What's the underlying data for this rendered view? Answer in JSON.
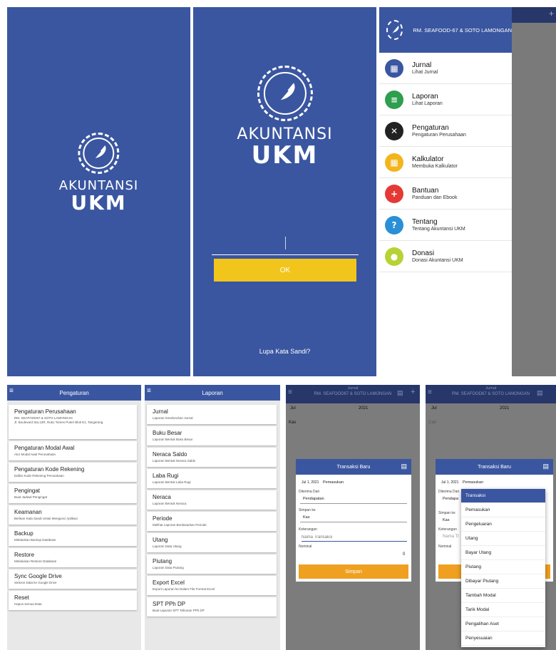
{
  "brand": {
    "word1": "AKUNTANSI",
    "word2": "UKM"
  },
  "login": {
    "ok_label": "OK",
    "forgot_label": "Lupa Kata Sandi?"
  },
  "drawer": {
    "title": "RM. SEAFOOD-67 & SOTO LAMONGAN",
    "items": [
      {
        "title": "Jurnal",
        "sub": "Lihat Jurnal",
        "icon": "calendar-icon",
        "color": "#3a56a0"
      },
      {
        "title": "Laporan",
        "sub": "Lihat Laporan",
        "icon": "document-icon",
        "color": "#2e9e4f"
      },
      {
        "title": "Pengaturan",
        "sub": "Pengaturan Perusahaan",
        "icon": "tools-icon",
        "color": "#222222"
      },
      {
        "title": "Kalkulator",
        "sub": "Membuka Kalkulator",
        "icon": "calculator-icon",
        "color": "#f2b51c"
      },
      {
        "title": "Bantuan",
        "sub": "Panduan dan Ebook",
        "icon": "plus-icon",
        "color": "#e53935"
      },
      {
        "title": "Tentang",
        "sub": "Tentang Akuntansi UKM",
        "icon": "question-icon",
        "color": "#2a8fd6"
      },
      {
        "title": "Donasi",
        "sub": "Donasi Akuntansi UKM",
        "icon": "coin-icon",
        "color": "#b5d334"
      }
    ]
  },
  "pengaturan": {
    "appbar": "Pengaturan",
    "items": [
      {
        "title": "Pengaturan Perusahaan",
        "sub": "RM. SEAFOOD67 & SOTO LAMONGAN",
        "sub2": "Jl. Boulevard Sta.12R, Ruko Tomes Puteri Blok E1, Tangerang"
      },
      {
        "title": "Pengaturan Modal Awal",
        "sub": "Atur Modal Awal Perusahaan"
      },
      {
        "title": "Pengaturan Kode Rekening",
        "sub": "Daftar Kode Rekening Perusahaan"
      },
      {
        "title": "Pengingat",
        "sub": "Buat Jadwal Pengingat"
      },
      {
        "title": "Keamanan",
        "sub": "Berikan Kata Sandi Untuk Mengunci Aplikasi"
      },
      {
        "title": "Backup",
        "sub": "Melakukan Backup Database"
      },
      {
        "title": "Restore",
        "sub": "Melakukan Restore Database"
      },
      {
        "title": "Sync Google Drive",
        "sub": "Sinkron Data ke Google Drive"
      },
      {
        "title": "Reset",
        "sub": "Hapus semua Data"
      }
    ]
  },
  "laporan": {
    "appbar": "Laporan",
    "items": [
      {
        "title": "Jurnal",
        "sub": "Laporan Keseluruhan Jurnal"
      },
      {
        "title": "Buku Besar",
        "sub": "Laporan Bentuk Buku Besar"
      },
      {
        "title": "Neraca Saldo",
        "sub": "Laporan Bentuk Neraca Saldo"
      },
      {
        "title": "Laba Rugi",
        "sub": "Laporan Bentuk Laba Rugi"
      },
      {
        "title": "Neraca",
        "sub": "Laporan Bentuk Neraca"
      },
      {
        "title": "Periode",
        "sub": "Melihat Laporan Berdasarkan Periode"
      },
      {
        "title": "Utang",
        "sub": "Laporan Data Utang"
      },
      {
        "title": "Piutang",
        "sub": "Laporan Data Piutang"
      },
      {
        "title": "Export Excel",
        "sub": "Export Laporan ke Dalam File Format Excel"
      },
      {
        "title": "SPT PPh DP",
        "sub": "Buat Laporan SPT Tahunan PPh DP"
      }
    ]
  },
  "jurnal": {
    "appbar_title": "Jurnal",
    "appbar_sub": "RM. SEAFOOD67 & SOTO LAMONGAN",
    "month": "Jul",
    "year": "2021",
    "kas": "Kas",
    "cari": "Cari"
  },
  "transaksi": {
    "title": "Transaksi Baru",
    "date": "Jul 1, 2021",
    "type": "Pemasukan",
    "diterima_label": "Diterima Dari",
    "diterima_value": "Pendapatan",
    "simpan_ke_label": "Simpan ke",
    "simpan_ke_value": "Kas",
    "keterangan_label": "Keterangan",
    "nama_placeholder": "Nama Transaksi",
    "nominal_label": "Nominal",
    "nominal_value": "0",
    "simpan_label": "Simpan",
    "dd_diterima": "Diterima Dari",
    "dd_pendapatan": "Pendapa",
    "dd_simpan": "Simpan ke",
    "dd_kas": "Kas",
    "dd_keterangan": "Keterangan",
    "dd_nama": "Nama Tr",
    "dd_nominal": "Nominal",
    "dropdown": [
      "Transaksi",
      "Pemasukan",
      "Pengeluaran",
      "Utang",
      "Bayar Utang",
      "Piutang",
      "Dibayar Piutang",
      "Tambah Modal",
      "Tarik Modal",
      "Pengalihan Aset",
      "Penyesuaian"
    ]
  },
  "colors": {
    "primary": "#3a56a0",
    "accent": "#f2b51c",
    "save": "#f0a020",
    "selected": "#3a56a0"
  }
}
